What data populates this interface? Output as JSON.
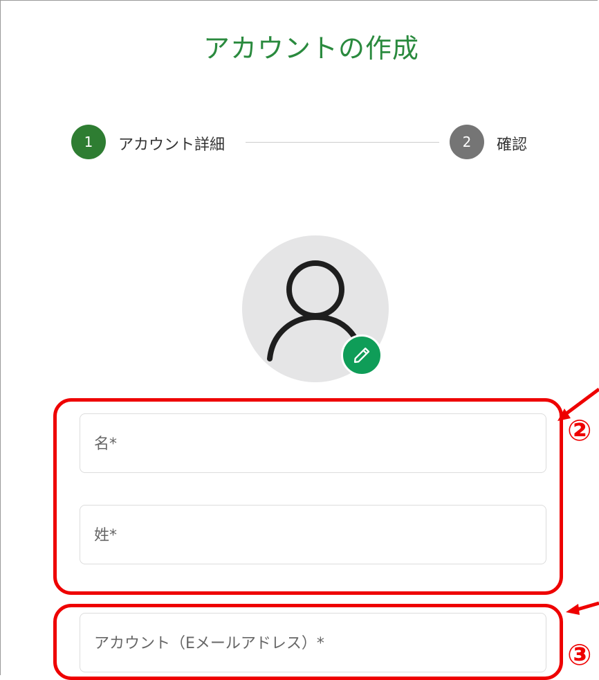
{
  "page": {
    "title": "アカウントの作成"
  },
  "stepper": {
    "steps": [
      {
        "number": "1",
        "label": "アカウント詳細",
        "state": "active"
      },
      {
        "number": "2",
        "label": "確認",
        "state": "inactive"
      }
    ]
  },
  "avatar": {
    "icon": "person-icon",
    "edit_icon": "pencil-icon"
  },
  "form": {
    "first_name": {
      "value": "",
      "placeholder": "名*"
    },
    "last_name": {
      "value": "",
      "placeholder": "姓*"
    },
    "account_email": {
      "value": "",
      "placeholder": "アカウント（Eメールアドレス）*"
    }
  },
  "annotations": {
    "callout_2": "②",
    "callout_3": "③",
    "color": "#ee0000"
  },
  "colors": {
    "brand_green": "#2a8a3e",
    "step_active": "#2e7d32",
    "step_inactive": "#757575",
    "edit_button": "#0f9d58"
  }
}
